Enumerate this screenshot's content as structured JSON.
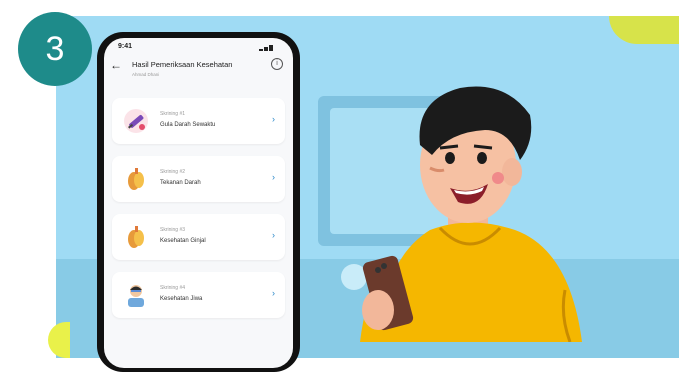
{
  "step_badge": "3",
  "phone": {
    "status_time": "9:41",
    "header": {
      "title": "Hasil Pemeriksaan Kesehatan",
      "subtitle": "Ahmad Dhani"
    },
    "cards": [
      {
        "label": "Skrining #1",
        "name": "Gula Darah Sewaktu",
        "icon": "syringe-icon"
      },
      {
        "label": "Skrining #2",
        "name": "Tekanan Darah",
        "icon": "organ-icon"
      },
      {
        "label": "Skrining #3",
        "name": "Kesehatan Ginjal",
        "icon": "kidney-icon"
      },
      {
        "label": "Skrining #4",
        "name": "Kesehatan Jiwa",
        "icon": "mental-health-icon"
      }
    ]
  },
  "colors": {
    "badge": "#1e8b8a",
    "background": "#9fdbf4",
    "chevron": "#2a88c9",
    "shirt": "#f5b700"
  }
}
